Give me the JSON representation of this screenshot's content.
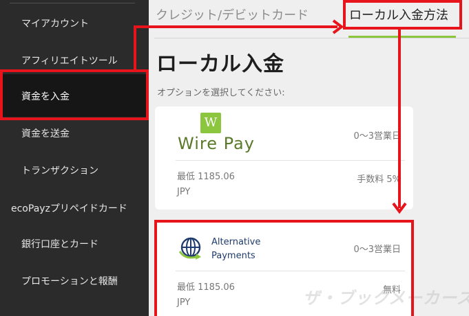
{
  "sidebar": {
    "items": [
      {
        "label": "マイアカウント",
        "active": false
      },
      {
        "label": "アフィリエイトツール",
        "active": false
      },
      {
        "label": "資金を入金",
        "active": true
      },
      {
        "label": "資金を送金",
        "active": false
      },
      {
        "label": "トランザクション",
        "active": false
      },
      {
        "label": "ecoPayzプリペイドカード",
        "active": false
      },
      {
        "label": "銀行口座とカード",
        "active": false
      },
      {
        "label": "プロモーションと報酬",
        "active": false
      }
    ]
  },
  "tabs": [
    {
      "label": "クレジット/デビットカード",
      "active": false
    },
    {
      "label": "ローカル入金方法",
      "active": true
    }
  ],
  "main": {
    "title": "ローカル入金",
    "subtitle": "オプションを選択してください:",
    "methods": [
      {
        "logo_text": "Wire Pay",
        "logo_mark": "W",
        "days": "0～3営業日",
        "min_line1": "最低 1185.06",
        "min_line2": "JPY",
        "fee": "手数料 5%"
      },
      {
        "name_line1": "Alternative",
        "name_line2": "Payments",
        "icon": "globe-arrow-icon",
        "days": "0～3営業日",
        "min_line1": "最低 1185.06",
        "min_line2": "JPY",
        "fee": "無料"
      }
    ]
  },
  "colors": {
    "accent": "#8cc63f",
    "annotation": "#e8141c",
    "sidebar_bg": "#2b2b2b"
  },
  "watermark": "ザ・ブックメーカーズ"
}
